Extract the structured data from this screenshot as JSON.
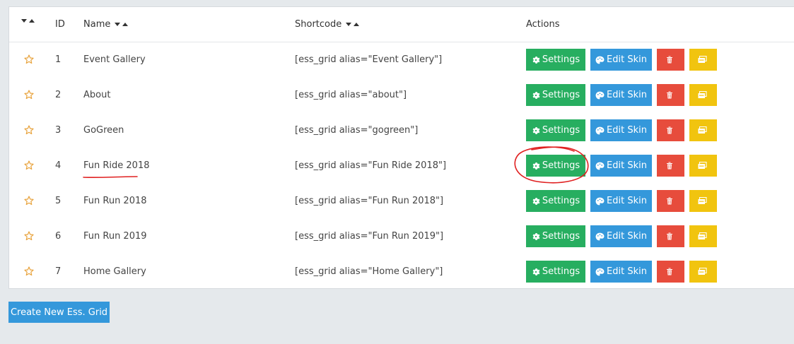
{
  "header": {
    "id_label": "ID",
    "name_label": "Name",
    "shortcode_label": "Shortcode",
    "actions_label": "Actions"
  },
  "actions": {
    "settings_label": "Settings",
    "edit_skin_label": "Edit Skin"
  },
  "rows": [
    {
      "id": "1",
      "name": "Event Gallery",
      "shortcode": "[ess_grid alias=\"Event Gallery\"]"
    },
    {
      "id": "2",
      "name": "About",
      "shortcode": "[ess_grid alias=\"about\"]"
    },
    {
      "id": "3",
      "name": "GoGreen",
      "shortcode": "[ess_grid alias=\"gogreen\"]"
    },
    {
      "id": "4",
      "name": "Fun Ride 2018",
      "shortcode": "[ess_grid alias=\"Fun Ride 2018\"]"
    },
    {
      "id": "5",
      "name": "Fun Run 2018",
      "shortcode": "[ess_grid alias=\"Fun Run 2018\"]"
    },
    {
      "id": "6",
      "name": "Fun Run 2019",
      "shortcode": "[ess_grid alias=\"Fun Run 2019\"]"
    },
    {
      "id": "7",
      "name": "Home Gallery",
      "shortcode": "[ess_grid alias=\"Home Gallery\"]"
    }
  ],
  "create_button_label": "Create New Ess. Grid",
  "colors": {
    "settings": "#27ae60",
    "edit_skin": "#3498db",
    "delete": "#e74c3c",
    "duplicate": "#f1c40f",
    "star": "#e8a33d",
    "annotation": "#e02020"
  }
}
